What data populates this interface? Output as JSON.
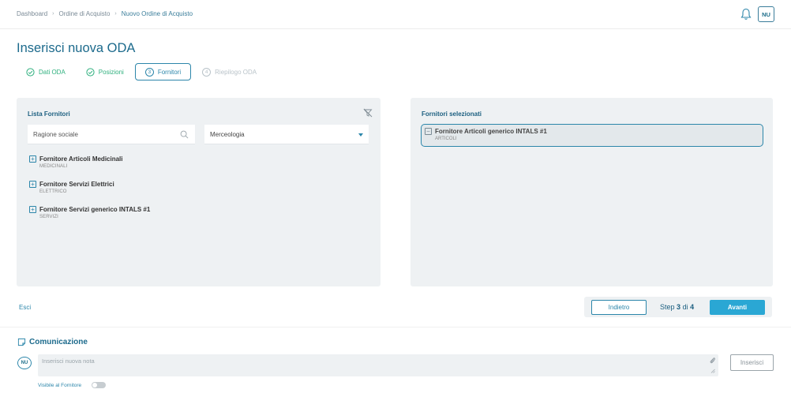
{
  "breadcrumb": [
    {
      "label": "Dashboard"
    },
    {
      "label": "Ordine di Acquisto"
    },
    {
      "label": "Nuovo Ordine di Acquisto"
    }
  ],
  "user": {
    "initials": "NU"
  },
  "page": {
    "title": "Inserisci nuova ODA"
  },
  "steps": [
    {
      "label": "Dati ODA",
      "status": "completed"
    },
    {
      "label": "Posizioni",
      "status": "completed"
    },
    {
      "label": "Fornitori",
      "number": "3",
      "status": "active"
    },
    {
      "label": "Riepilogo ODA",
      "number": "4",
      "status": "disabled"
    }
  ],
  "supplier_list": {
    "title": "Lista Fornitori",
    "search_placeholder": "Ragione sociale",
    "category_select": "Merceologia",
    "items": [
      {
        "name": "Fornitore Articoli Medicinali",
        "category": "MEDICINALI"
      },
      {
        "name": "Fornitore Servizi Elettrici",
        "category": "ELETTRICO"
      },
      {
        "name": "Fornitore Servizi generico INTALS #1",
        "category": "SERVIZI"
      }
    ]
  },
  "selected_suppliers": {
    "title": "Fornitori selezionati",
    "items": [
      {
        "name": "Fornitore Articoli generico INTALS #1",
        "category": "ARTICOLI"
      }
    ]
  },
  "footer": {
    "exit_label": "Esci",
    "back_label": "Indietro",
    "step_prefix": "Step",
    "step_current": "3",
    "step_sep": "di",
    "step_total": "4",
    "next_label": "Avanti"
  },
  "communication": {
    "title": "Comunicazione",
    "avatar": "NU",
    "note_placeholder": "Inserisci nuova nota",
    "insert_label": "Inserisci",
    "visible_label": "Visibile al Fornitore",
    "visible_to_supplier": false
  },
  "colors": {
    "primary": "#1c6a8c",
    "accent": "#2aa7d4",
    "success": "#2fb07e",
    "panel": "#eef1f3"
  }
}
